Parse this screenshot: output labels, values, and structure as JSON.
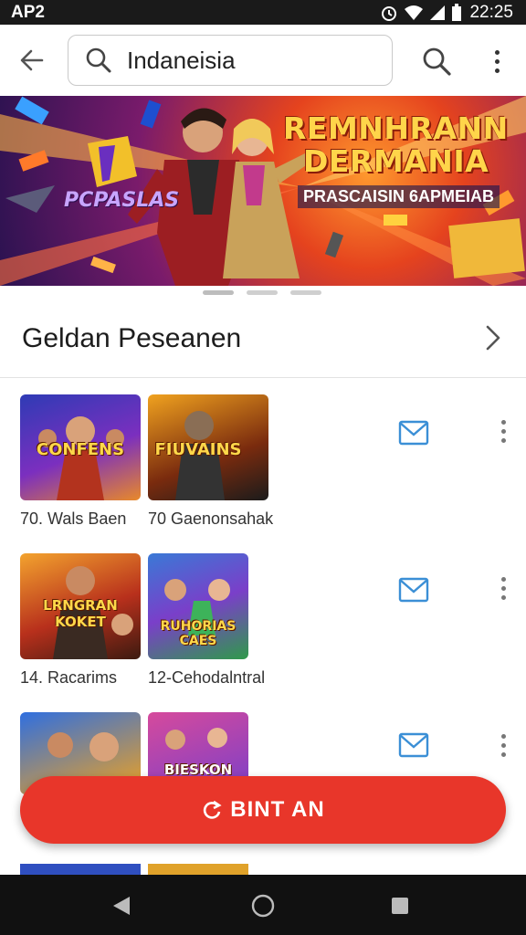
{
  "status_bar": {
    "carrier": "AP2",
    "time": "22:25"
  },
  "search": {
    "value": "Indaneisia"
  },
  "banner": {
    "title_line1": "REMNHRANN",
    "title_line2": "DERMANIA",
    "subtitle": "PRASCAISIN 6APMEIAB",
    "logo_text": "PCPASLAS",
    "page_count": 3,
    "active_page": 1
  },
  "section": {
    "title": "Geldan Peseanen"
  },
  "rows": [
    {
      "items": [
        {
          "art_text": "CONFENS",
          "label": "70. Wals Baen"
        },
        {
          "art_text": "FIUVAINS",
          "label": "70 Gaenonsahak"
        }
      ]
    },
    {
      "items": [
        {
          "art_text": "LRNGRAN KOKET",
          "label": "14. Racarims"
        },
        {
          "art_text": "RUHORIAS CAES",
          "label": "12-Cehodalntral"
        }
      ]
    },
    {
      "items": [
        {
          "art_text": "",
          "label": ""
        },
        {
          "art_text": "BIESKON",
          "label": ""
        }
      ]
    }
  ],
  "fab": {
    "label": "BINT AN"
  },
  "colors": {
    "accent": "#e8362a",
    "mail_icon": "#3b8fd6"
  }
}
